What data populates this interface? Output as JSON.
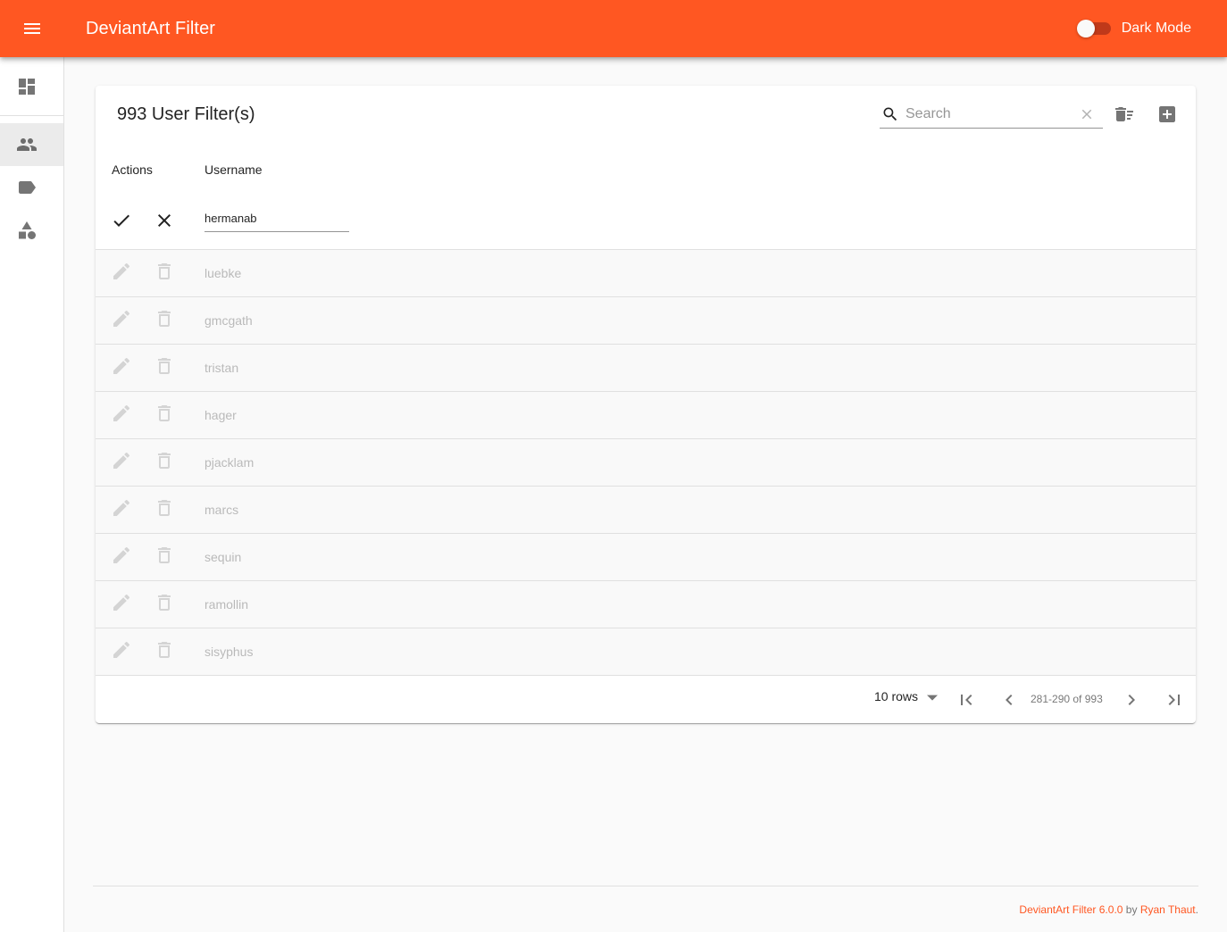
{
  "appbar": {
    "title": "DeviantArt Filter",
    "dark_mode_label": "Dark Mode",
    "accent_color": "#ff5722"
  },
  "drawer": {
    "items": [
      {
        "icon": "dashboard-icon",
        "selected": false
      },
      {
        "icon": "people-icon",
        "selected": true
      },
      {
        "icon": "label-icon",
        "selected": false
      },
      {
        "icon": "category-icon",
        "selected": false
      }
    ]
  },
  "table": {
    "title": "993 User Filter(s)",
    "search_placeholder": "Search",
    "search_value": "",
    "columns": {
      "actions": "Actions",
      "username": "Username"
    },
    "edit_value": "hermanab",
    "rows": [
      "luebke",
      "gmcgath",
      "tristan",
      "hager",
      "pjacklam",
      "marcs",
      "sequin",
      "ramollin",
      "sisyphus"
    ],
    "pagination": {
      "rows_label": "10 rows",
      "range": "281-290 of 993"
    }
  },
  "footer": {
    "app_link": "DeviantArt Filter 6.0.0",
    "by": "by",
    "author_link": "Ryan Thaut",
    "period": "."
  }
}
